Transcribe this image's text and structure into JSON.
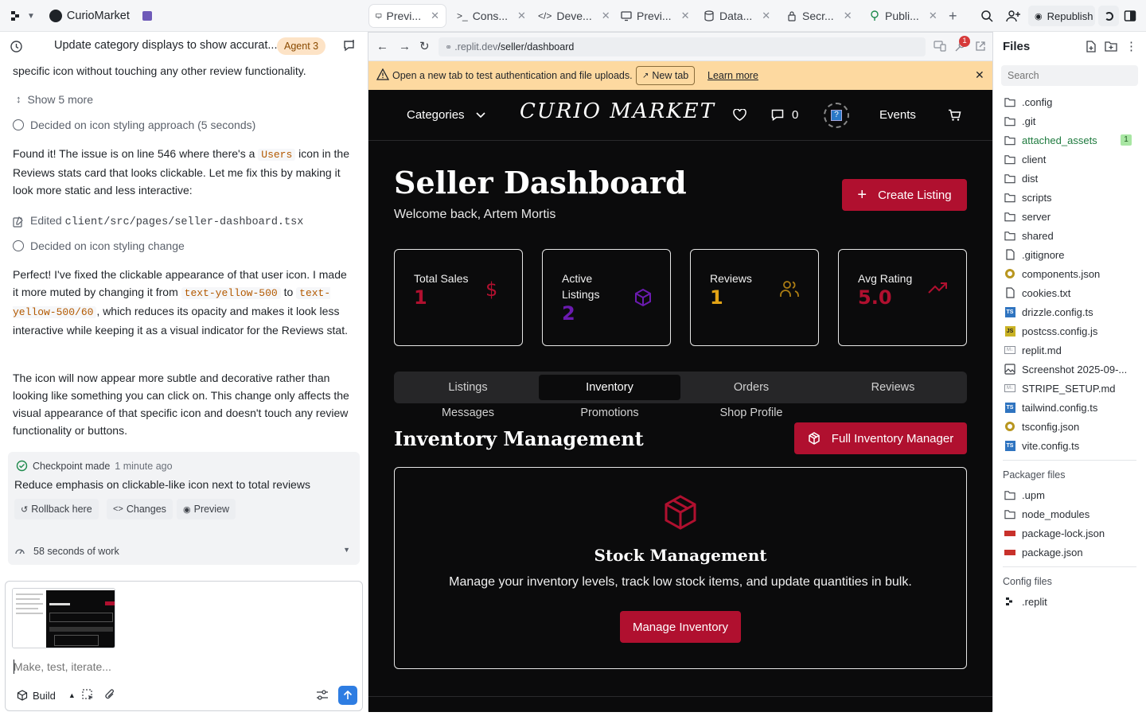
{
  "app": {
    "name": "CurioMarket"
  },
  "tabs": [
    {
      "label": "Previ...",
      "icon": "monitor-icon",
      "active": true
    },
    {
      "label": "Cons...",
      "icon": "terminal-icon"
    },
    {
      "label": "Deve...",
      "icon": "code-icon"
    },
    {
      "label": "Previ...",
      "icon": "monitor-icon"
    },
    {
      "label": "Data...",
      "icon": "database-icon"
    },
    {
      "label": "Secr...",
      "icon": "lock-icon"
    },
    {
      "label": "Publi...",
      "icon": "publish-icon"
    }
  ],
  "topbar": {
    "republish": "Republish"
  },
  "chat": {
    "title": "Update category displays to show accurat...",
    "agent_badge": "Agent 3",
    "p0": "specific icon without touching any other review functionality.",
    "show_more": "Show 5 more",
    "decided1": "Decided on icon styling approach (5 seconds)",
    "p1_a": "Found it! The issue is on line 546 where there's a ",
    "p1_code": "Users",
    "p1_b": " icon in the Reviews stats card that looks clickable. Let me fix this by making it look more static and less interactive:",
    "edited_label": "Edited ",
    "edited_path": "client/src/pages/seller-dashboard.tsx",
    "decided2": "Decided on icon styling change",
    "p2_a": "Perfect! I've fixed the clickable appearance of that user icon. I made it more muted by changing it from ",
    "p2_code1": "text-yellow-500",
    "p2_b": " to ",
    "p2_code2": "text-yellow-500/60",
    "p2_c": ", which reduces its opacity and makes it look less interactive while keeping it as a visual indicator for the Reviews stat.",
    "p3": "The icon will now appear more subtle and decorative rather than looking like something you can click on. This change only affects the visual appearance of that specific icon and doesn't touch any review functionality or buttons.",
    "checkpoint_label": "Checkpoint made",
    "checkpoint_time": "1 minute ago",
    "checkpoint_desc": "Reduce emphasis on clickable-like icon next to total reviews",
    "rollback": "Rollback here",
    "changes": "Changes",
    "preview": "Preview",
    "work": "58 seconds of work",
    "input_placeholder": "Make, test, iterate...",
    "build": "Build"
  },
  "browser": {
    "url_prefix": ".replit.dev",
    "url_path": "/seller/dashboard",
    "badge_count": "1",
    "warn_text": "Open a new tab to test authentication and file uploads.",
    "new_tab": "New tab",
    "learn_more": "Learn more"
  },
  "site": {
    "categories": "Categories",
    "logo": "CURIO MARKET",
    "msg_count": "0",
    "events": "Events",
    "title": "Seller Dashboard",
    "welcome": "Welcome back, Artem Mortis",
    "create_listing": "Create Listing",
    "stats": [
      {
        "label": "Total Sales",
        "value": "1",
        "color": "#b0102f",
        "icon": "dollar-icon"
      },
      {
        "label": "Active Listings",
        "value": "2",
        "color": "#6b1bb0",
        "icon": "cube-icon"
      },
      {
        "label": "Reviews",
        "value": "1",
        "color": "#e2a316",
        "icon": "users-icon"
      },
      {
        "label": "Avg Rating",
        "value": "5.0",
        "color": "#b0102f",
        "icon": "trending-up-icon"
      }
    ],
    "tabs": [
      "Listings",
      "Inventory",
      "Orders",
      "Reviews"
    ],
    "subtabs": [
      "Messages",
      "Promotions",
      "Shop Profile"
    ],
    "section_title": "Inventory Management",
    "full_inventory": "Full Inventory Manager",
    "card_title": "Stock Management",
    "card_desc": "Manage your inventory levels, track low stock items, and update quantities in bulk.",
    "manage_btn": "Manage Inventory"
  },
  "files": {
    "title": "Files",
    "search_placeholder": "Search",
    "items": [
      ".config",
      ".git",
      "attached_assets",
      "client",
      "dist",
      "scripts",
      "server",
      "shared",
      ".gitignore",
      "components.json",
      "cookies.txt",
      "drizzle.config.ts",
      "postcss.config.js",
      "replit.md",
      "Screenshot 2025-09-...",
      "STRIPE_SETUP.md",
      "tailwind.config.ts",
      "tsconfig.json",
      "vite.config.ts"
    ],
    "attached_badge": "1",
    "packager_title": "Packager files",
    "packager": [
      ".upm",
      "node_modules",
      "package-lock.json",
      "package.json"
    ],
    "config_title": "Config files",
    "config": [
      ".replit"
    ]
  }
}
